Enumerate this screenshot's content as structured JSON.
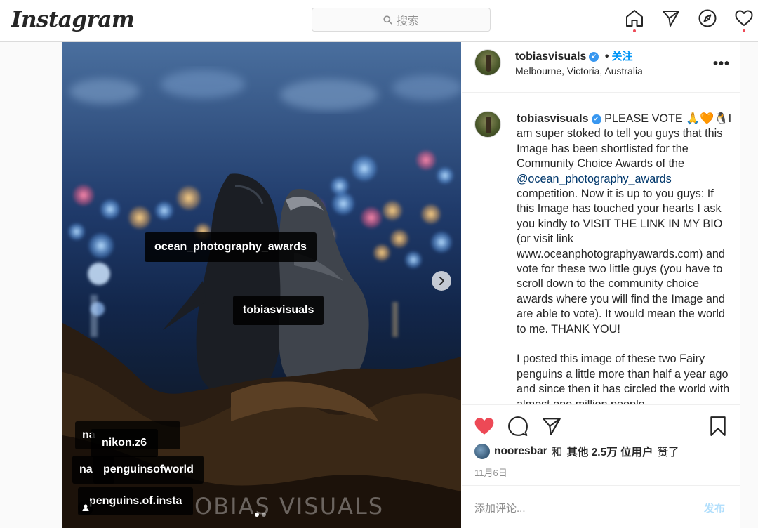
{
  "header": {
    "logo": "Instagram",
    "search_placeholder": "搜索",
    "colors": {
      "notification_dot": "#ed4956",
      "link_blue": "#0095f6"
    },
    "nav_icons": [
      "home-icon",
      "direct-icon",
      "explore-icon",
      "activity-heart-icon"
    ]
  },
  "photo": {
    "tags": {
      "ocean": "ocean_photography_awards",
      "tobias": "tobiasvisuals",
      "natgeo": "natgeofineart",
      "na1": "na",
      "na2": "na",
      "nikon": "nikon.z6",
      "penguinsofworld": "penguinsofworld",
      "penguins_insta": "penguins.of.insta"
    },
    "watermark": "OBIAS VISUALS",
    "pager": {
      "current": 1,
      "total": 2
    }
  },
  "post": {
    "username": "tobiasvisuals",
    "dot": "•",
    "follow_label": "关注",
    "location": "Melbourne, Victoria, Australia",
    "more": "•••",
    "caption": {
      "username": "tobiasvisuals",
      "line1_before_mention": "PLEASE VOTE 🙏🧡🐧I am super stoked to tell you guys that this Image has been shortlisted for the Community Choice Awards of the",
      "mention": "@ocean_photography_awards",
      "line1_after_mention": "competition. Now it is up to you guys: If this Image has touched your hearts I ask you kindly to VISIT THE LINK IN MY BIO (or visit link www.oceanphotographyawards.com) and vote for these two little guys (you have to scroll down to the community choice awards where you will find the Image and are able to vote). It would mean the world to me. THANK YOU!",
      "paragraph2": "I posted this image of these two Fairy penguins a little more than half a year ago and since then it has circled the world with almost one million people"
    },
    "likes": {
      "user": "nooresbar",
      "connector": "和",
      "others": "其他 2.5万 位用户",
      "suffix": "赞了"
    },
    "date": "11月6日",
    "comment_placeholder": "添加评论...",
    "post_button": "发布",
    "like_color": "#ed4956"
  }
}
